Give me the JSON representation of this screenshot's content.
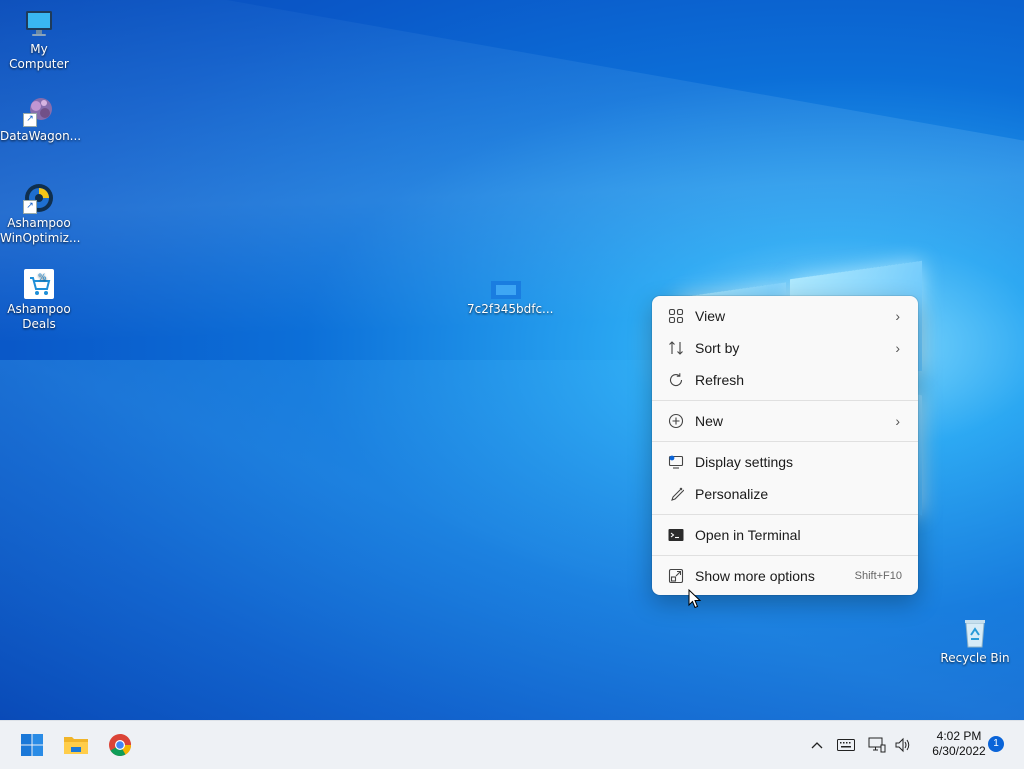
{
  "desktop": {
    "icons": [
      {
        "label": "My Computer"
      },
      {
        "label": "DataWagon..."
      },
      {
        "label": "Ashampoo WinOptimiz..."
      },
      {
        "label": "Ashampoo Deals"
      },
      {
        "label": "7c2f345bdfc..."
      },
      {
        "label": "Recycle Bin"
      }
    ]
  },
  "context_menu": {
    "items": [
      {
        "label": "View",
        "icon": "grid-icon",
        "submenu": true
      },
      {
        "label": "Sort by",
        "icon": "sort-icon",
        "submenu": true
      },
      {
        "label": "Refresh",
        "icon": "refresh-icon"
      },
      {
        "label": "New",
        "icon": "plus-circle-icon",
        "submenu": true
      },
      {
        "label": "Display settings",
        "icon": "display-icon"
      },
      {
        "label": "Personalize",
        "icon": "brush-icon"
      },
      {
        "label": "Open in Terminal",
        "icon": "terminal-icon"
      },
      {
        "label": "Show more options",
        "icon": "more-options-icon",
        "shortcut": "Shift+F10"
      }
    ]
  },
  "taskbar": {
    "apps": [
      {
        "name": "Start",
        "icon": "windows-start-icon"
      },
      {
        "name": "File Explorer",
        "icon": "folder-icon"
      },
      {
        "name": "Google Chrome",
        "icon": "chrome-icon"
      }
    ],
    "clock": {
      "time": "4:02 PM",
      "date": "6/30/2022"
    },
    "notification_count": "1"
  },
  "colors": {
    "accent": "#0a64d8",
    "desktop_bg": "#0c6fd8",
    "menu_bg": "#f9f9f9"
  }
}
